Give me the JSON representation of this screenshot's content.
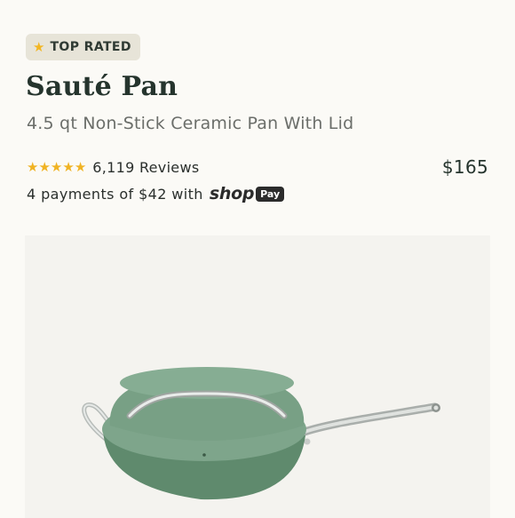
{
  "badge": {
    "icon": "star-icon",
    "text": "TOP RATED"
  },
  "product": {
    "title": "Sauté Pan",
    "subtitle": "4.5 qt Non-Stick Ceramic Pan With Lid",
    "rating": 5,
    "reviews": "6,119 Reviews",
    "price": "$165"
  },
  "payments": {
    "text": "4 payments of $42 with",
    "brand": "shop",
    "pay_label": "Pay"
  },
  "colors": {
    "accent_star": "#f0b323",
    "pan_green": "#6f9b7d",
    "background": "#fbfaf6"
  }
}
